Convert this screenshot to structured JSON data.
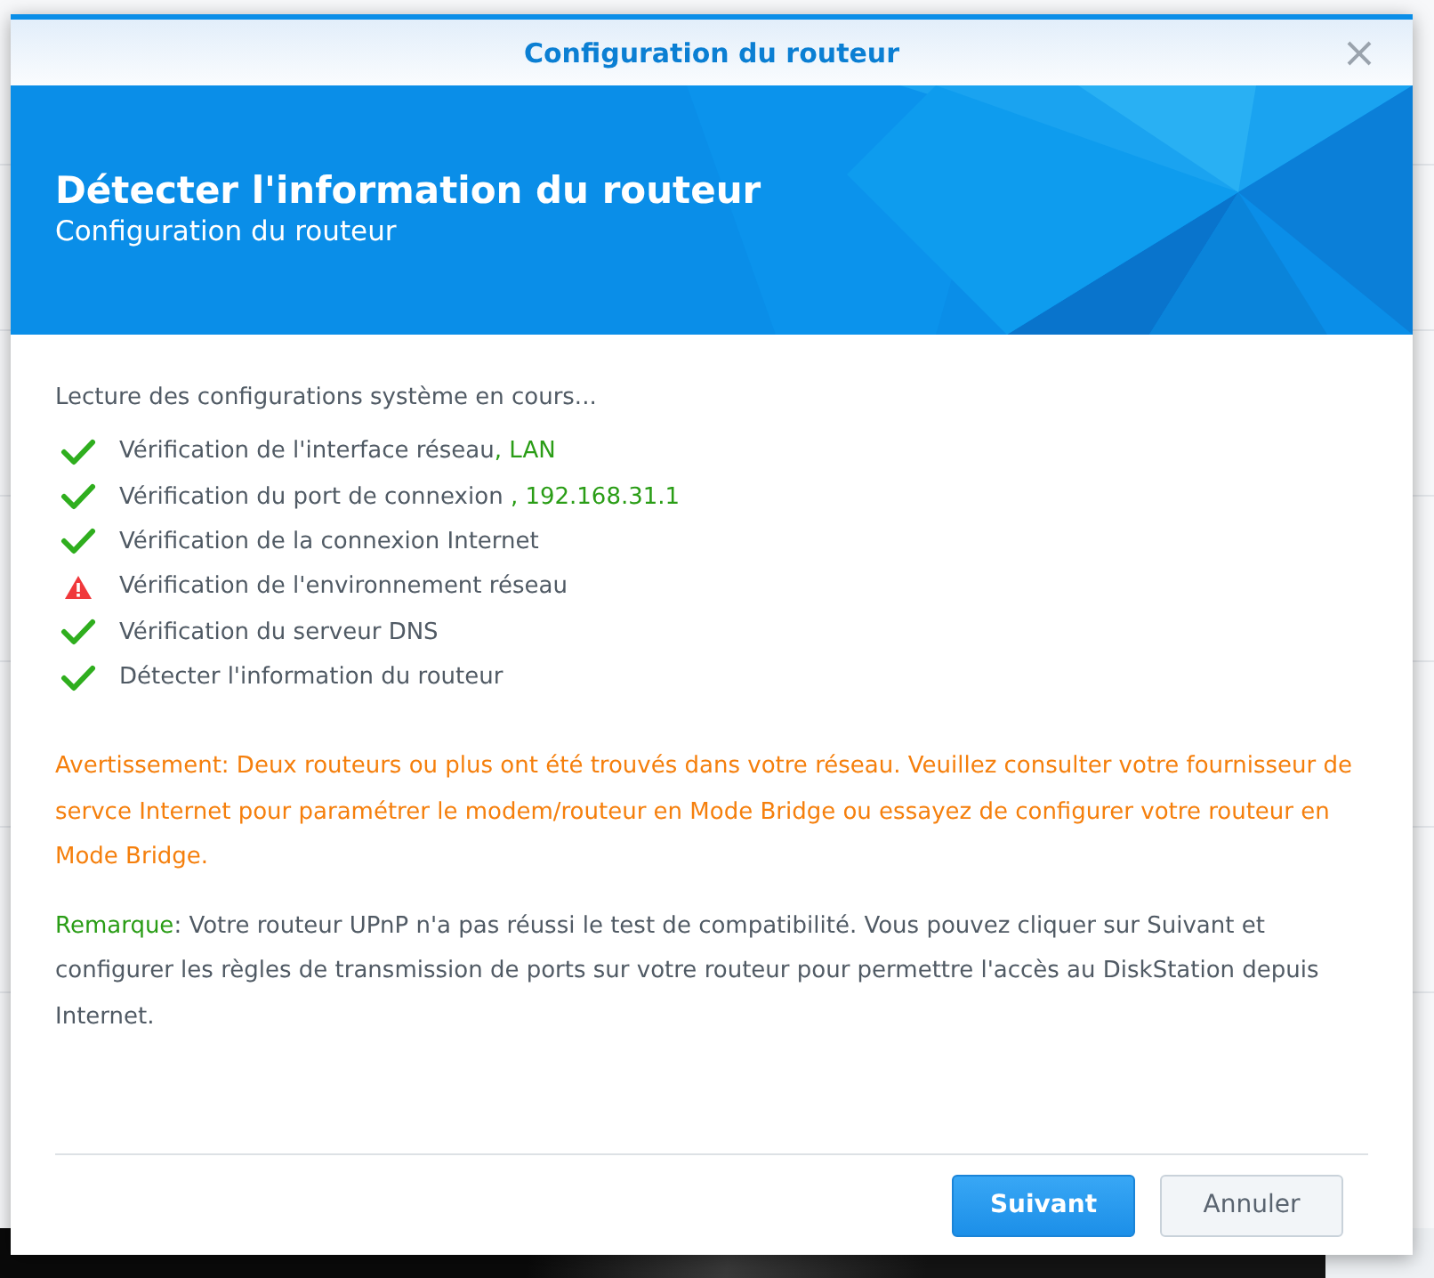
{
  "dialog": {
    "title": "Configuration du routeur",
    "heading": "Détecter l'information du routeur",
    "subheading": "Configuration du routeur"
  },
  "intro": "Lecture des configurations système en cours...",
  "checks": [
    {
      "kind": "ok",
      "label": "Vérification de l'interface réseau",
      "detail": ", LAN"
    },
    {
      "kind": "ok",
      "label": "Vérification du port de connexion",
      "detail": " , 192.168.31.1"
    },
    {
      "kind": "ok",
      "label": "Vérification de la connexion Internet"
    },
    {
      "kind": "warning",
      "label": "Vérification de l'environnement réseau"
    },
    {
      "kind": "ok",
      "label": "Vérification du serveur DNS"
    },
    {
      "kind": "ok",
      "label": "Détecter l'information du routeur"
    }
  ],
  "warning": "Avertissement: Deux routeurs ou plus ont été trouvés dans votre réseau. Veuillez consulter votre fournisseur de servce Internet pour paramétrer le modem/routeur en Mode Bridge ou essayez de configurer votre routeur en Mode Bridge.",
  "note": {
    "label": "Remarque",
    "text": ": Votre routeur UPnP n'a pas réussi le test de compatibilité. Vous pouvez cliquer sur Suivant et configurer les règles de transmission de ports sur votre routeur pour permettre l'accès au DiskStation depuis Internet."
  },
  "buttons": [
    {
      "kind": "primary",
      "label": "Suivant"
    },
    {
      "kind": "secondary",
      "label": "Annuler"
    }
  ]
}
